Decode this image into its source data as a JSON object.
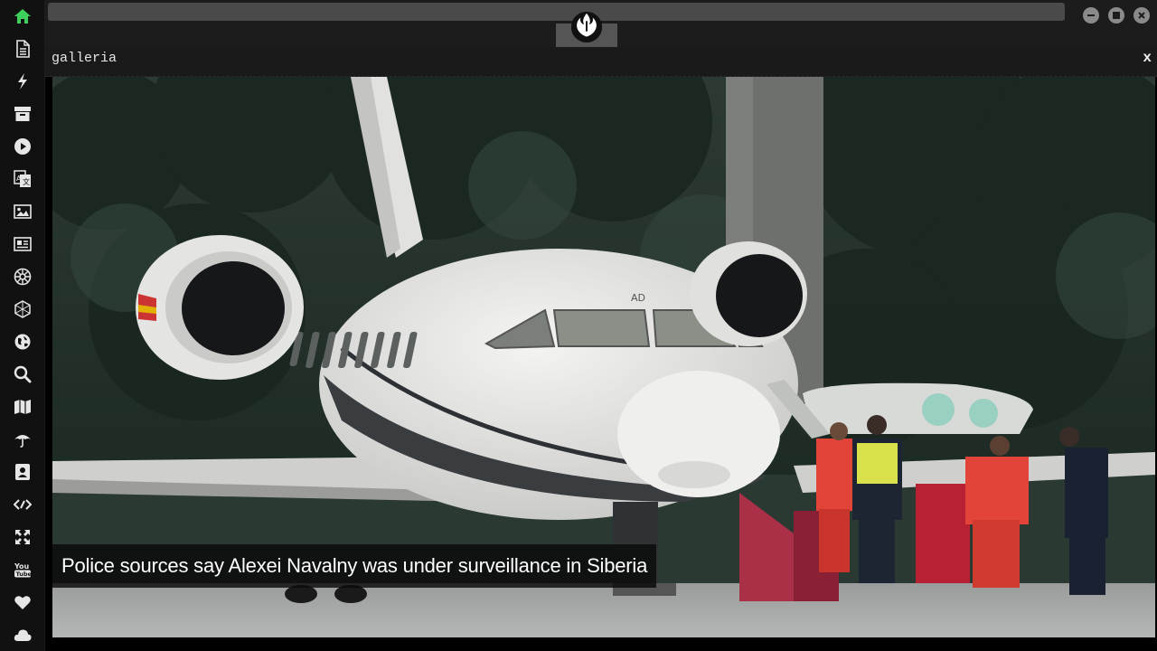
{
  "panel": {
    "title": "galleria",
    "close_label": "x"
  },
  "gallery": {
    "caption": "Police sources say Alexei Navalny was under surveillance in Siberia"
  },
  "sidebar": {
    "items": [
      {
        "name": "home-icon",
        "color": "#3ecf5c"
      },
      {
        "name": "document-icon",
        "color": "#e6e6e6"
      },
      {
        "name": "lightning-icon",
        "color": "#e6e6e6"
      },
      {
        "name": "archive-icon",
        "color": "#e6e6e6"
      },
      {
        "name": "play-circle-icon",
        "color": "#e6e6e6"
      },
      {
        "name": "translate-icon",
        "color": "#e6e6e6"
      },
      {
        "name": "image-icon",
        "color": "#e6e6e6"
      },
      {
        "name": "newspaper-icon",
        "color": "#e6e6e6"
      },
      {
        "name": "empire-icon",
        "color": "#e6e6e6"
      },
      {
        "name": "hexagon-icon",
        "color": "#e6e6e6"
      },
      {
        "name": "globe-icon",
        "color": "#e6e6e6"
      },
      {
        "name": "search-icon",
        "color": "#e6e6e6"
      },
      {
        "name": "map-icon",
        "color": "#e6e6e6"
      },
      {
        "name": "umbrella-icon",
        "color": "#e6e6e6"
      },
      {
        "name": "contact-card-icon",
        "color": "#e6e6e6"
      },
      {
        "name": "code-icon",
        "color": "#e6e6e6"
      },
      {
        "name": "expand-icon",
        "color": "#e6e6e6"
      },
      {
        "name": "youtube-icon",
        "color": "#e6e6e6"
      },
      {
        "name": "heart-icon",
        "color": "#e6e6e6"
      },
      {
        "name": "cloud-icon",
        "color": "#e6e6e6"
      }
    ]
  },
  "window_controls": [
    "minimize-icon",
    "maximize-icon",
    "close-icon"
  ],
  "colors": {
    "accent": "#3ecf5c",
    "sidebar_bg": "#111111",
    "topbar_bg": "#1c1c1c"
  }
}
